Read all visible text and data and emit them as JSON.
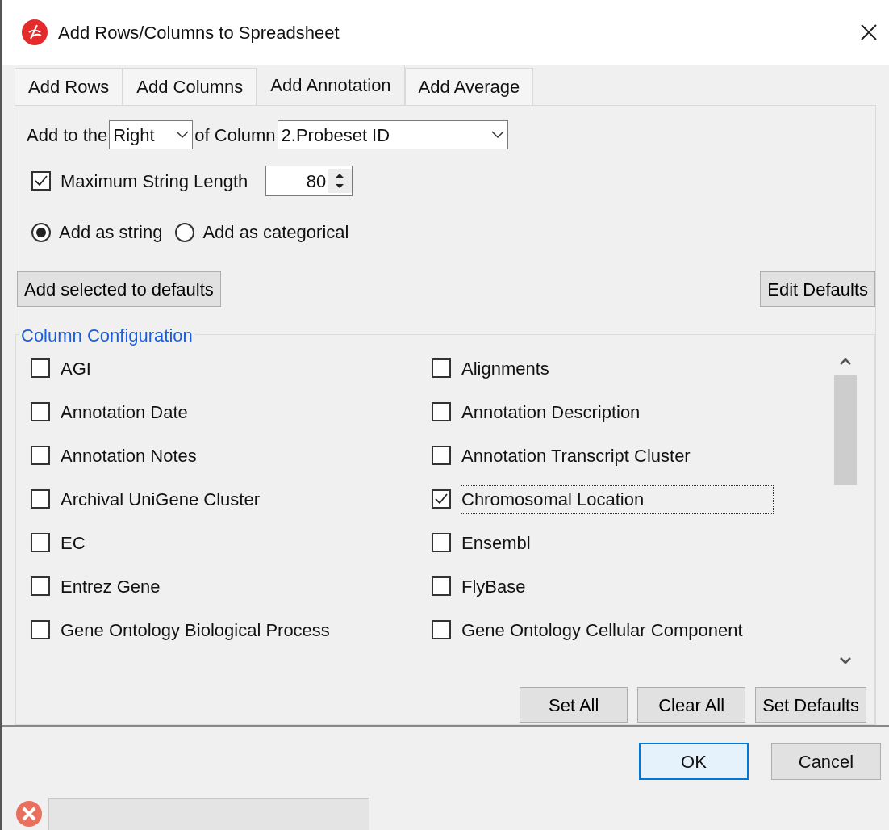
{
  "window": {
    "title": "Add Rows/Columns to Spreadsheet"
  },
  "tabs": [
    {
      "label": "Add Rows",
      "selected": false
    },
    {
      "label": "Add Columns",
      "selected": false
    },
    {
      "label": "Add Annotation",
      "selected": true
    },
    {
      "label": "Add Average",
      "selected": false
    }
  ],
  "position_row": {
    "prefix": "Add to the",
    "side": "Right",
    "middle": "of Column",
    "column": "2.Probeset ID"
  },
  "max_length": {
    "label": "Maximum String Length",
    "checked": true,
    "value": "80"
  },
  "add_as": [
    {
      "label": "Add as string",
      "selected": true
    },
    {
      "label": "Add as categorical",
      "selected": false
    }
  ],
  "default_buttons": [
    "Add selected to defaults",
    "Edit Defaults"
  ],
  "column_configuration": {
    "title": "Column Configuration",
    "items": [
      {
        "label": "AGI",
        "checked": false,
        "focused": false
      },
      {
        "label": "Alignments",
        "checked": false,
        "focused": false
      },
      {
        "label": "Annotation Date",
        "checked": false,
        "focused": false
      },
      {
        "label": "Annotation Description",
        "checked": false,
        "focused": false
      },
      {
        "label": "Annotation Notes",
        "checked": false,
        "focused": false
      },
      {
        "label": "Annotation Transcript Cluster",
        "checked": false,
        "focused": false
      },
      {
        "label": "Archival UniGene Cluster",
        "checked": false,
        "focused": false
      },
      {
        "label": "Chromosomal Location",
        "checked": true,
        "focused": true
      },
      {
        "label": "EC",
        "checked": false,
        "focused": false
      },
      {
        "label": "Ensembl",
        "checked": false,
        "focused": false
      },
      {
        "label": "Entrez Gene",
        "checked": false,
        "focused": false
      },
      {
        "label": "FlyBase",
        "checked": false,
        "focused": false
      },
      {
        "label": "Gene Ontology Biological Process",
        "checked": false,
        "focused": false
      },
      {
        "label": "Gene Ontology Cellular Component",
        "checked": false,
        "focused": false
      }
    ],
    "buttons": [
      "Set All",
      "Clear All",
      "Set Defaults"
    ]
  },
  "dialog_buttons": [
    {
      "label": "OK",
      "default": true
    },
    {
      "label": "Cancel",
      "default": false
    }
  ]
}
